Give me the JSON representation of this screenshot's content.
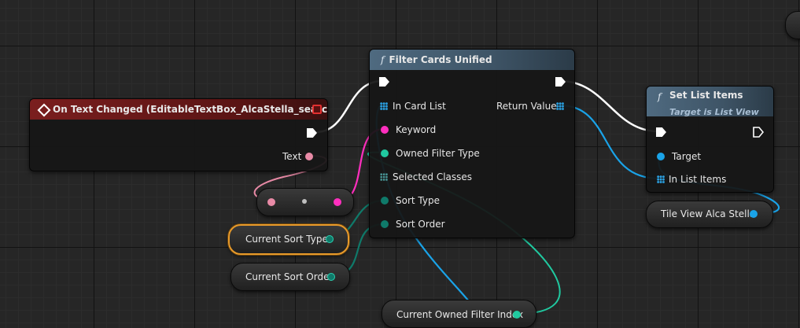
{
  "event_node": {
    "title": "On Text Changed (EditableTextBox_AlcaStella_search)",
    "pins": {
      "text": "Text"
    }
  },
  "filter_node": {
    "title": "Filter Cards Unified",
    "inputs": {
      "in_card_list": "In Card List",
      "keyword": "Keyword",
      "owned_filter_type": "Owned Filter Type",
      "selected_classes": "Selected Classes",
      "sort_type": "Sort Type",
      "sort_order": "Sort Order"
    },
    "outputs": {
      "return_value": "Return Value"
    }
  },
  "set_list_node": {
    "title": "Set List Items",
    "subtitle": "Target is List View",
    "inputs": {
      "target": "Target",
      "in_list_items": "In List Items"
    }
  },
  "variables": {
    "tile_view": "Tile View Alca Stella",
    "current_sort_type": "Current Sort Type",
    "current_sort_order": "Current Sort Order",
    "current_owned_filter_index": "Current Owned Filter Index"
  },
  "colors": {
    "exec": "#ffffff",
    "object": "#1aa3e8",
    "string": "#ff2fbe",
    "text": "#e88aa6",
    "enum": "#0f7a6a",
    "byte": "#20c9a0",
    "event_header": "#7a1e1e",
    "function_header": "#4f6a80",
    "selection": "#e89a2a"
  }
}
